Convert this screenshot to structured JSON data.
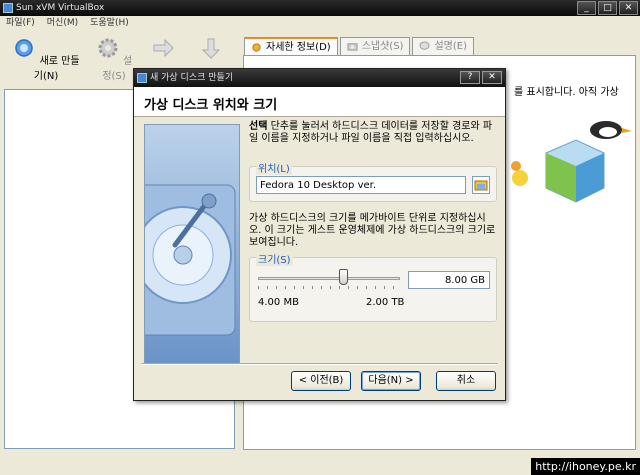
{
  "main_window": {
    "title": "Sun xVM VirtualBox",
    "menu": [
      "파일(F)",
      "머신(M)",
      "도움말(H)"
    ],
    "toolbar": {
      "new_label": "새로 만들기(N)",
      "settings_label": "설정(S)"
    },
    "tabs": [
      {
        "label": "자세한 정보(D)",
        "active": true
      },
      {
        "label": "스냅샷(S)",
        "active": false
      },
      {
        "label": "설명(E)",
        "active": false
      }
    ],
    "details_partial_text": "를 표시합니다. 아직 가상"
  },
  "dialog": {
    "title": "새 가상 디스크 만들기",
    "heading": "가상 디스크 위치와 크기",
    "intro_bold": "선택",
    "intro_rest": " 단추를 눌러서 하드디스크 데이터를 저장할 경로와 파일 이름을 지정하거나 파일 이름을 직접 입력하십시오.",
    "location": {
      "label": "위치(L)",
      "value": "Fedora 10 Desktop ver."
    },
    "size_description": "가상 하드디스크의 크기를 메가바이트 단위로 지정하십시오. 이 크기는 게스트 운영체제에 가상 하드디스크의 크기로 보여집니다.",
    "size": {
      "label": "크기(S)",
      "value": "8.00 GB",
      "min_label": "4.00 MB",
      "max_label": "2.00 TB",
      "slider_fraction": 0.6
    },
    "buttons": {
      "back": "< 이전(B)",
      "next": "다음(N) >",
      "cancel": "취소"
    }
  },
  "watermark": "http://ihoney.pe.kr",
  "colors": {
    "accent": "#1d5bbd",
    "tab_highlight": "#e68b2c",
    "window_bg": "#ece9d8"
  }
}
